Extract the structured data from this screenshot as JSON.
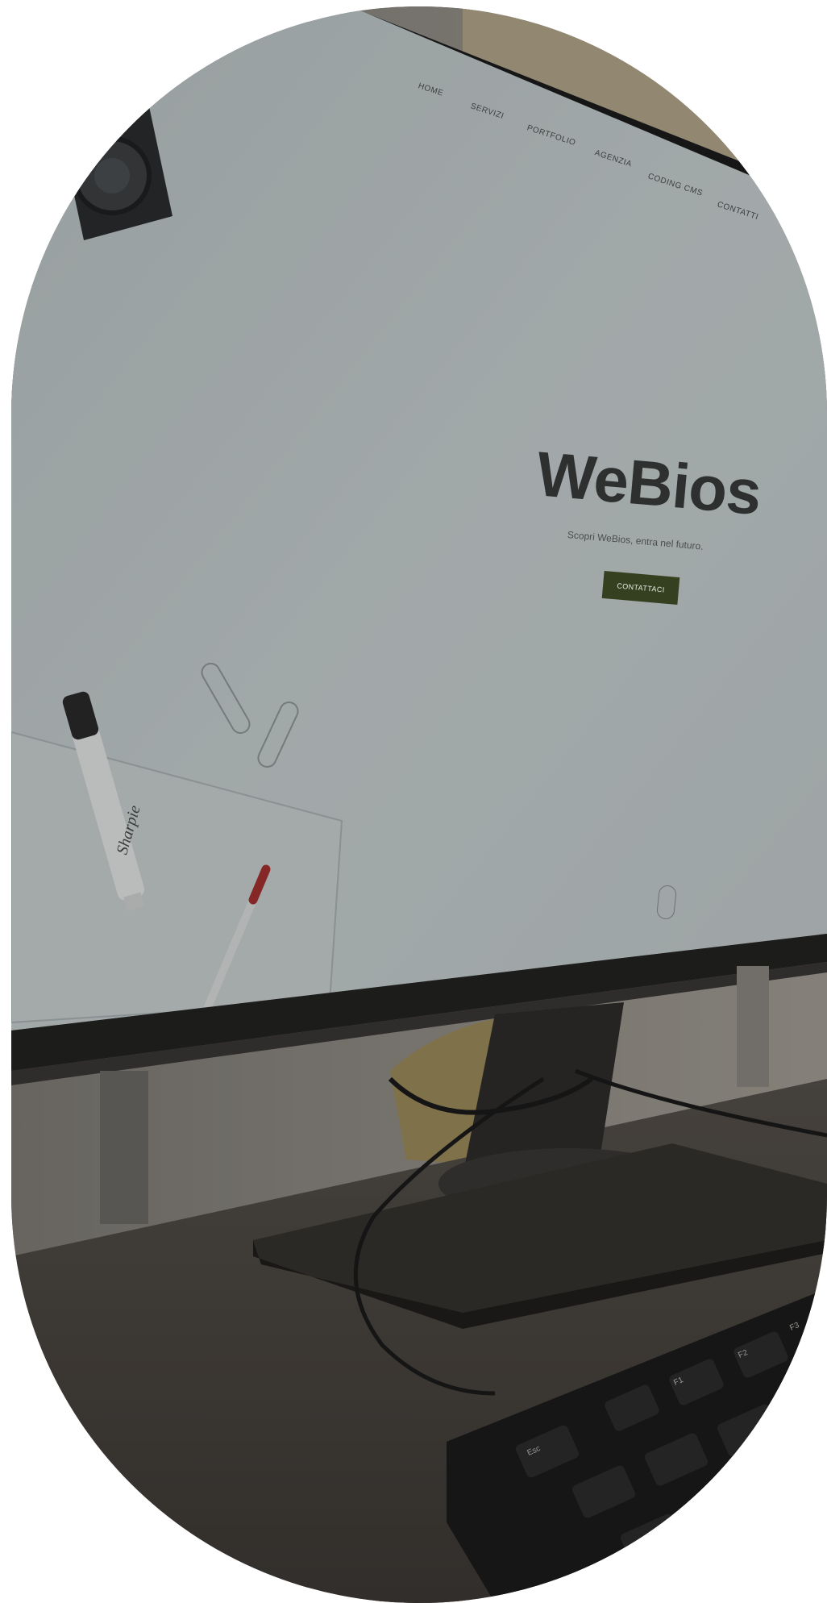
{
  "screen": {
    "nav": [
      "HOME",
      "SERVIZI",
      "PORTFOLIO",
      "AGENZIA",
      "CODING CMS",
      "CONTATTI"
    ],
    "hero_title": "WeBios",
    "hero_subtitle": "Scopri WeBios, entra nel futuro.",
    "cta_label": "CONTATTACI"
  },
  "desk": {
    "marker_brand": "Sharpie",
    "keyboard_keys": [
      "Esc",
      "F1",
      "F2",
      "F3"
    ]
  },
  "colors": {
    "screen_bg": "#d8dedd",
    "cta_bg": "#34401f",
    "desk": "#4a4540",
    "wall": "#9a968e"
  }
}
